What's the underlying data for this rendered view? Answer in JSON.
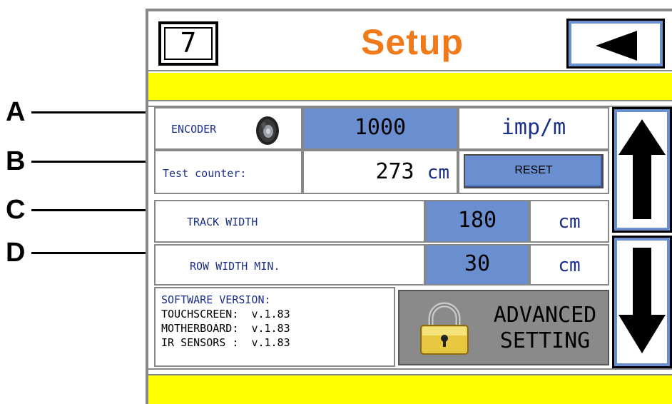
{
  "callouts": [
    {
      "letter": "A"
    },
    {
      "letter": "B"
    },
    {
      "letter": "C"
    },
    {
      "letter": "D"
    }
  ],
  "header": {
    "page_number": "7",
    "title": "Setup",
    "back_icon": "back-arrow-icon"
  },
  "encoder": {
    "label": "ENCODER",
    "icon": "wheel-icon",
    "value": "1000",
    "unit": "imp/m"
  },
  "test_counter": {
    "label": "Test counter:",
    "value": "273",
    "unit": "cm",
    "reset_label": "RESET"
  },
  "track_width": {
    "label": "TRACK WIDTH",
    "value": "180",
    "unit": "cm"
  },
  "row_width_min": {
    "label": "ROW WIDTH MIN.",
    "value": "30",
    "unit": "cm"
  },
  "software_version": {
    "title": "SOFTWARE VERSION:",
    "rows": [
      {
        "name": "TOUCHSCREEN:",
        "version": "v.1.83"
      },
      {
        "name": "MOTHERBOARD:",
        "version": "v.1.83"
      },
      {
        "name": "IR SENSORS :",
        "version": "v.1.83"
      }
    ]
  },
  "advanced": {
    "line1": "ADVANCED",
    "line2": "SETTING",
    "icon": "padlock-icon"
  },
  "scroll": {
    "up_icon": "arrow-up-icon",
    "down_icon": "arrow-down-icon"
  },
  "colors": {
    "title_orange": "#f07a1a",
    "yellow_bar": "#ffff00",
    "field_blue": "#6a8fd0",
    "label_blue": "#1a2f8a",
    "panel_gray": "#8a8a8a"
  }
}
